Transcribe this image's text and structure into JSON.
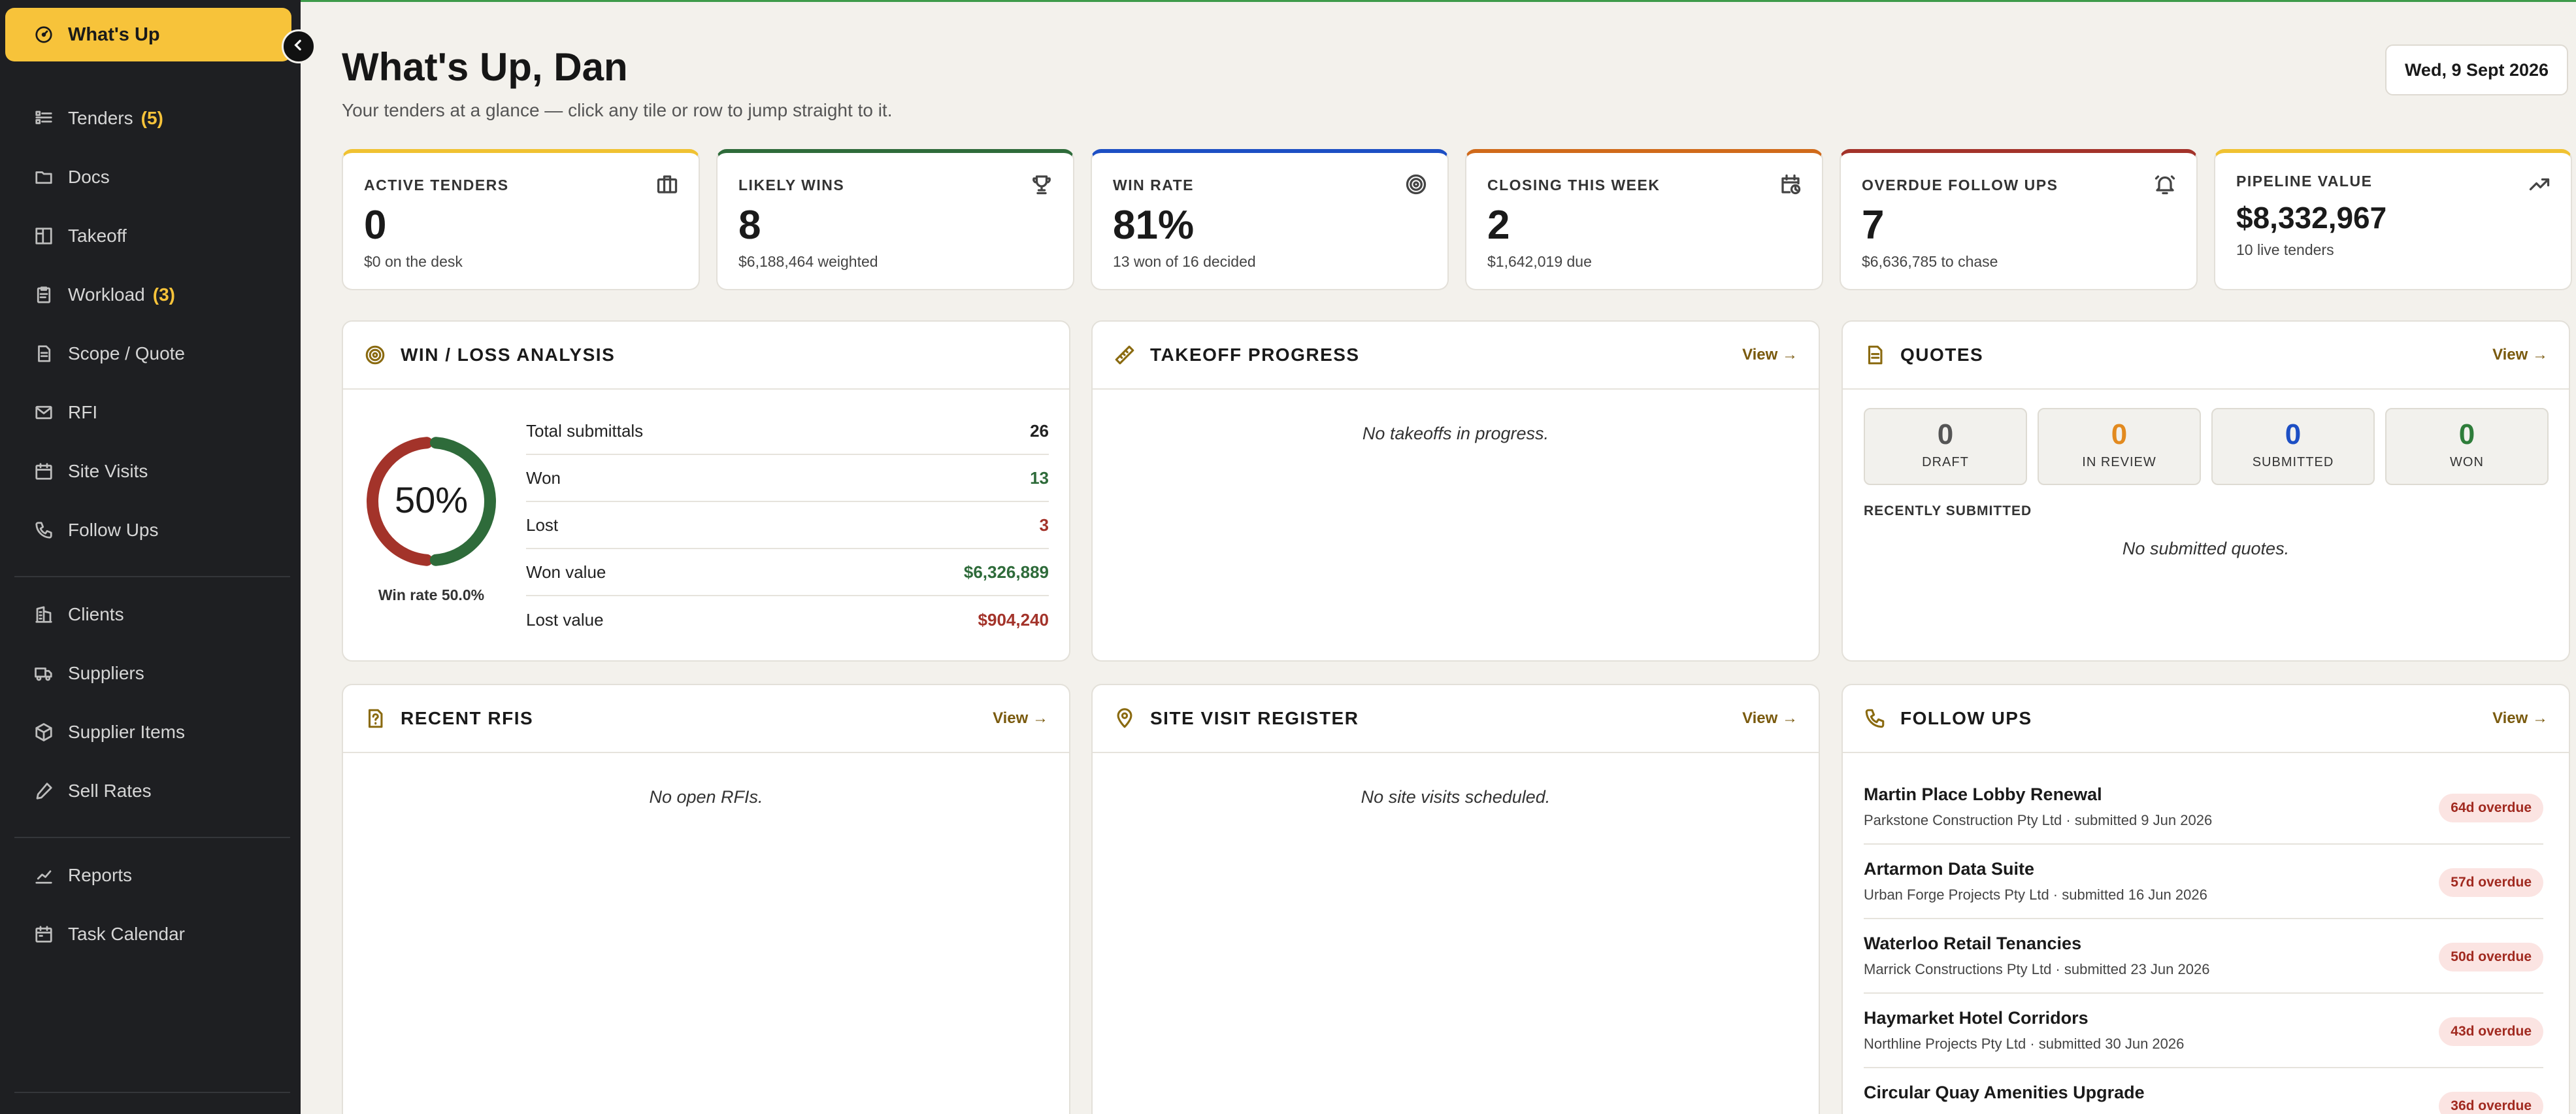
{
  "colors": {
    "accent": "#f7c33a",
    "sidebar_bg": "#1e1f22",
    "won": "#2e6b3a",
    "lost": "#a3332a",
    "quote_review": "#e28a1f",
    "quote_submitted": "#1d4fc4",
    "quote_won": "#2e7d3a"
  },
  "sidebar": {
    "active": {
      "label": "What's Up",
      "icon": "gauge-icon"
    },
    "items": [
      {
        "label": "Tenders",
        "count": "(5)",
        "icon": "list-icon"
      },
      {
        "label": "Docs",
        "icon": "folder-icon"
      },
      {
        "label": "Takeoff",
        "icon": "blueprint-icon"
      },
      {
        "label": "Workload",
        "count": "(3)",
        "icon": "clipboard-icon"
      },
      {
        "label": "Scope / Quote",
        "icon": "document-icon"
      },
      {
        "label": "RFI",
        "icon": "mail-icon"
      },
      {
        "label": "Site Visits",
        "icon": "calendar-icon"
      },
      {
        "label": "Follow Ups",
        "icon": "phone-icon"
      },
      {
        "label": "Clients",
        "icon": "building-icon"
      },
      {
        "label": "Suppliers",
        "icon": "truck-icon"
      },
      {
        "label": "Supplier Items",
        "icon": "box-icon"
      },
      {
        "label": "Sell Rates",
        "icon": "tag-icon"
      },
      {
        "label": "Reports",
        "icon": "chart-icon"
      },
      {
        "label": "Task Calendar",
        "icon": "calendar-icon"
      }
    ]
  },
  "header": {
    "title": "What's Up, Dan",
    "subtitle": "Your tenders at a glance — click any tile or row to jump straight to it.",
    "date": "Wed, 9 Sept 2026"
  },
  "tiles": [
    {
      "label": "ACTIVE TENDERS",
      "value": "0",
      "sub": "$0 on the desk",
      "color": "#f0c232",
      "icon": "briefcase-icon"
    },
    {
      "label": "LIKELY WINS",
      "value": "8",
      "sub": "$6,188,464 weighted",
      "color": "#2e6b3a",
      "icon": "trophy-icon"
    },
    {
      "label": "WIN RATE",
      "value": "81%",
      "sub": "13 won of 16 decided",
      "color": "#1d4fc4",
      "icon": "target-icon"
    },
    {
      "label": "CLOSING THIS WEEK",
      "value": "2",
      "sub": "$1,642,019 due",
      "color": "#d06a1a",
      "icon": "calendar-clock-icon"
    },
    {
      "label": "OVERDUE FOLLOW UPS",
      "value": "7",
      "sub": "$6,636,785 to chase",
      "color": "#a3332a",
      "icon": "bell-icon"
    },
    {
      "label": "PIPELINE VALUE",
      "value": "$8,332,967",
      "sub": "10 live tenders",
      "color": "#f0c232",
      "icon": "trend-up-icon"
    }
  ],
  "winloss": {
    "title": "WIN / LOSS ANALYSIS",
    "percent": "50%",
    "rate_label": "Win rate 50.0%",
    "won_fraction": 0.5,
    "rows": [
      {
        "label": "Total submittals",
        "value": "26"
      },
      {
        "label": "Won",
        "value": "13"
      },
      {
        "label": "Lost",
        "value": "3"
      },
      {
        "label": "Won value",
        "value": "$6,326,889"
      },
      {
        "label": "Lost value",
        "value": "$904,240"
      }
    ]
  },
  "takeoff": {
    "title": "TAKEOFF PROGRESS",
    "view": "View →",
    "empty": "No takeoffs in progress."
  },
  "quotes": {
    "title": "QUOTES",
    "view": "View →",
    "stats": [
      {
        "n": "0",
        "label": "DRAFT"
      },
      {
        "n": "0",
        "label": "IN REVIEW"
      },
      {
        "n": "0",
        "label": "SUBMITTED"
      },
      {
        "n": "0",
        "label": "WON"
      }
    ],
    "recent_label": "RECENTLY SUBMITTED",
    "empty": "No submitted quotes."
  },
  "rfis": {
    "title": "RECENT RFIS",
    "view": "View →",
    "empty": "No open RFIs."
  },
  "sitevisits": {
    "title": "SITE VISIT REGISTER",
    "view": "View →",
    "empty": "No site visits scheduled."
  },
  "followups": {
    "title": "FOLLOW UPS",
    "view": "View →",
    "items": [
      {
        "name": "Martin Place Lobby Renewal",
        "sub": "Parkstone Construction Pty Ltd · submitted 9 Jun 2026",
        "badge": "64d overdue"
      },
      {
        "name": "Artarmon Data Suite",
        "sub": "Urban Forge Projects Pty Ltd · submitted 16 Jun 2026",
        "badge": "57d overdue"
      },
      {
        "name": "Waterloo Retail Tenancies",
        "sub": "Marrick Constructions Pty Ltd · submitted 23 Jun 2026",
        "badge": "50d overdue"
      },
      {
        "name": "Haymarket Hotel Corridors",
        "sub": "Northline Projects Pty Ltd · submitted 30 Jun 2026",
        "badge": "43d overdue"
      },
      {
        "name": "Circular Quay Amenities Upgrade",
        "sub": "",
        "badge": "36d overdue"
      }
    ]
  }
}
